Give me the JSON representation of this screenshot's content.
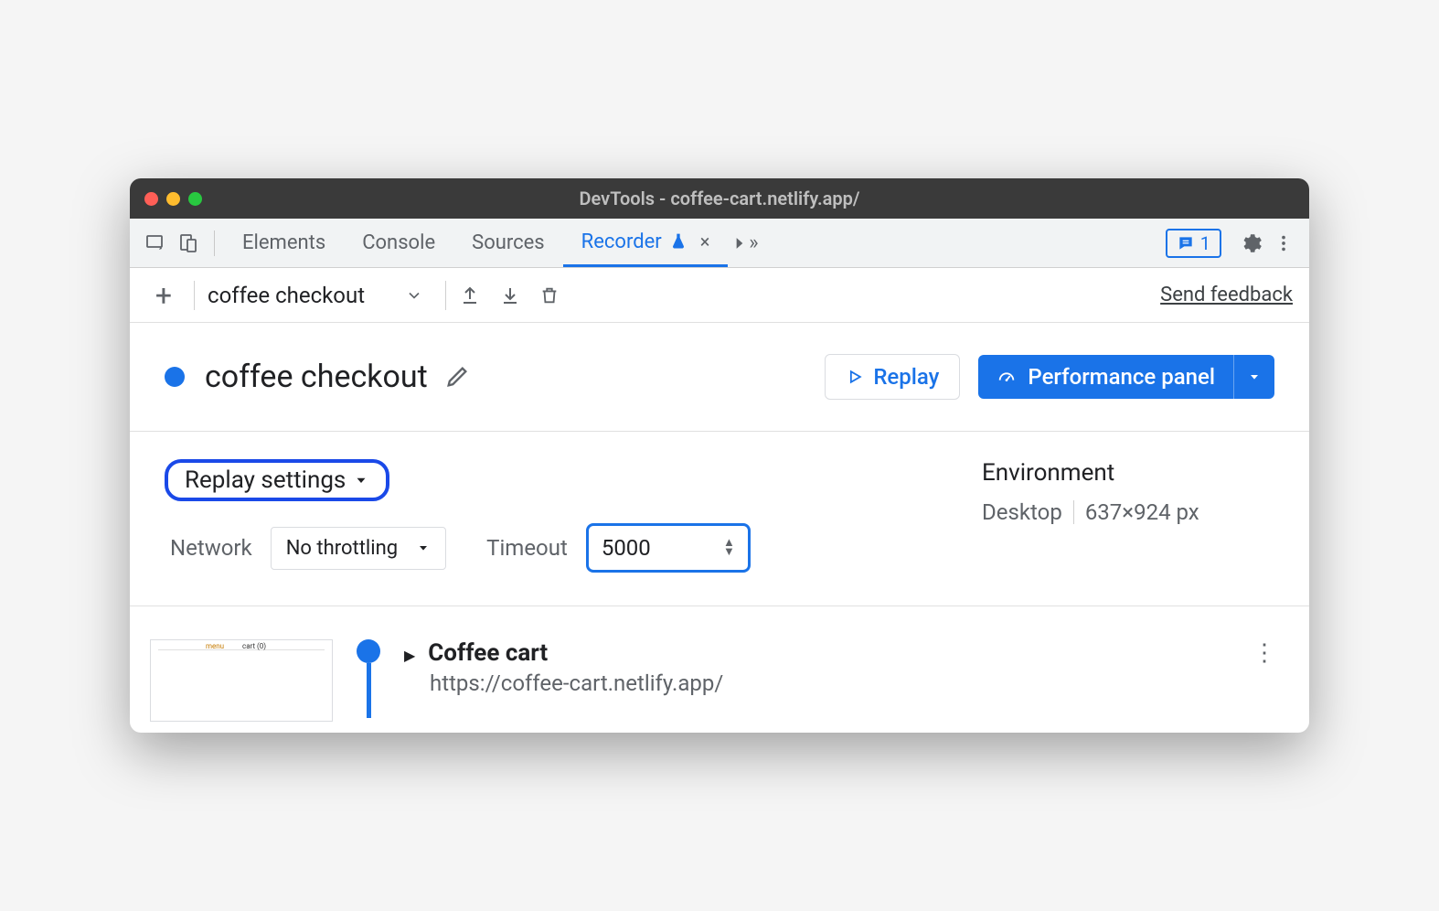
{
  "window": {
    "title": "DevTools - coffee-cart.netlify.app/"
  },
  "tabs": {
    "elements": "Elements",
    "console": "Console",
    "sources": "Sources",
    "recorder": "Recorder",
    "issues_count": "1"
  },
  "toolbar": {
    "recording_name": "coffee checkout",
    "feedback": "Send feedback"
  },
  "header": {
    "title": "coffee checkout",
    "replay": "Replay",
    "performance": "Performance panel"
  },
  "settings": {
    "replay_settings": "Replay settings",
    "network_label": "Network",
    "network_value": "No throttling",
    "timeout_label": "Timeout",
    "timeout_value": "5000"
  },
  "environment": {
    "title": "Environment",
    "device": "Desktop",
    "viewport": "637×924 px"
  },
  "step": {
    "title": "Coffee cart",
    "url": "https://coffee-cart.netlify.app/"
  }
}
